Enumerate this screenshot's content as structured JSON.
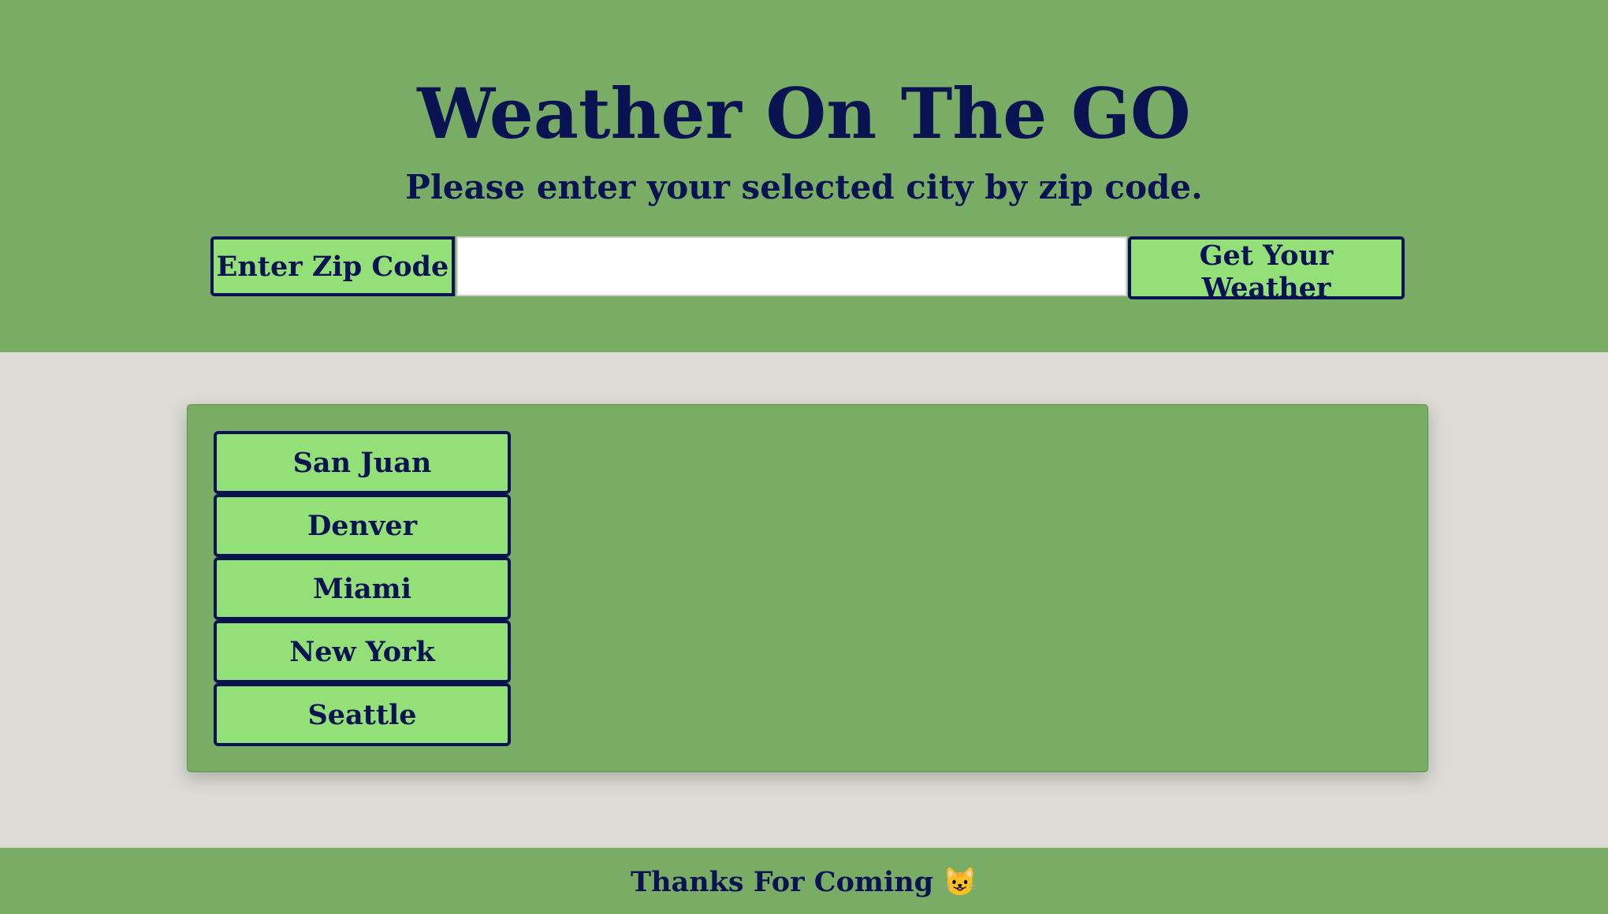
{
  "header": {
    "title": "Weather On The GO",
    "subtitle": "Please enter your selected city by zip code.",
    "zip_label": "Enter Zip Code",
    "zip_input_value": "",
    "zip_input_placeholder": "",
    "submit_label": "Get Your Weather"
  },
  "cities": [
    "San Juan",
    "Denver",
    "Miami",
    "New York",
    "Seattle"
  ],
  "footer": {
    "text": "Thanks For Coming 😺"
  },
  "colors": {
    "header_bg": "#79ac65",
    "page_bg": "#dcdcd5",
    "button_bg": "#93e078",
    "text": "#0a1352"
  }
}
